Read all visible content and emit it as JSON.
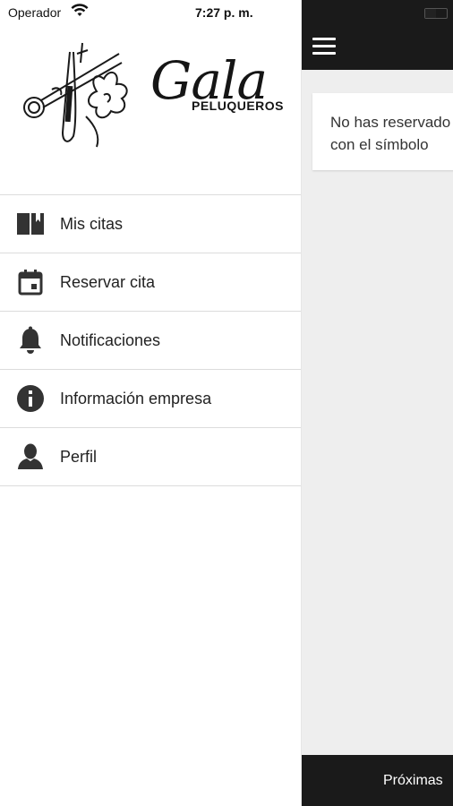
{
  "status_bar": {
    "carrier": "Operador",
    "time": "7:27 p. m."
  },
  "logo": {
    "word": "Gala",
    "subtitle": "PELUQUEROS"
  },
  "menu": {
    "items": [
      {
        "label": "Mis citas",
        "icon": "book-icon"
      },
      {
        "label": "Reservar cita",
        "icon": "calendar-icon"
      },
      {
        "label": "Notificaciones",
        "icon": "bell-icon"
      },
      {
        "label": "Información empresa",
        "icon": "info-icon"
      },
      {
        "label": "Perfil",
        "icon": "person-icon"
      }
    ]
  },
  "content": {
    "card_text_line1": "No has reservado",
    "card_text_line2": "con el símbolo"
  },
  "bottom_tabs": {
    "upcoming": "Próximas"
  },
  "colors": {
    "dark_bar": "#1a1a1a",
    "background": "#eeeeee",
    "divider": "#dcdcdc"
  }
}
